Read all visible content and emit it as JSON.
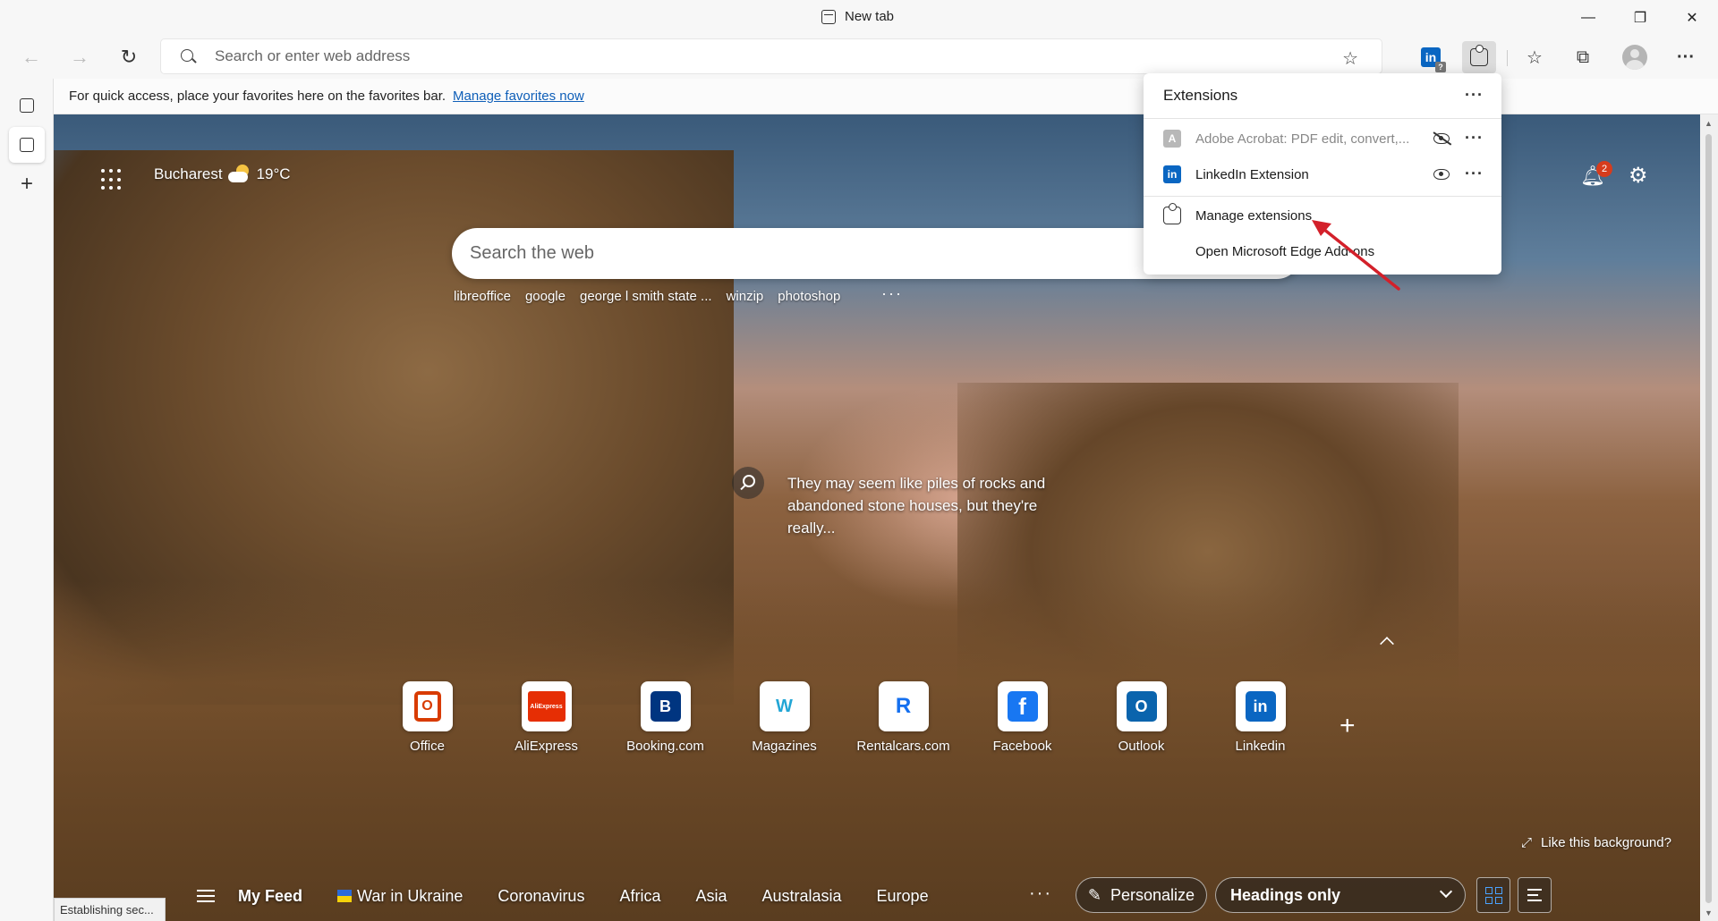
{
  "window": {
    "tab_title": "New tab",
    "minimize": "—",
    "restore": "❐",
    "close": "✕"
  },
  "toolbar": {
    "back": "←",
    "forward": "→",
    "refresh": "↻",
    "address_placeholder": "Search or enter web address",
    "favorites_star": "☆",
    "favorites": "☆",
    "collections": "⧉",
    "more": "···",
    "linkedin_badge": "in",
    "linkedin_q": "?"
  },
  "favbar": {
    "text": "For quick access, place your favorites here on the favorites bar.",
    "link": "Manage favorites now"
  },
  "sidebar": {
    "add": "+"
  },
  "ntp": {
    "city": "Bucharest",
    "temperature": "19°C",
    "notifications_count": "2",
    "search_placeholder": "Search the web",
    "suggestions": [
      "libreoffice",
      "google",
      "george l smith state ...",
      "winzip",
      "photoshop"
    ],
    "suggestions_more": "···",
    "caption": "They may seem like piles of rocks and abandoned stone houses, but they're really...",
    "like_background": "Like this background?",
    "add_link": "+"
  },
  "quicklinks": [
    {
      "label": "Office",
      "logo": "O",
      "color": "#d83b01"
    },
    {
      "label": "AliExpress",
      "logo": "AliExpress",
      "color": "#e62e04"
    },
    {
      "label": "Booking.com",
      "logo": "B",
      "color": "#003580"
    },
    {
      "label": "Magazines",
      "logo": "W",
      "color": "#23a6d5"
    },
    {
      "label": "Rentalcars.com",
      "logo": "R",
      "color": "#1570ef"
    },
    {
      "label": "Facebook",
      "logo": "f",
      "color": "#1877f2"
    },
    {
      "label": "Outlook",
      "logo": "O",
      "color": "#0a64ad"
    },
    {
      "label": "Linkedin",
      "logo": "in",
      "color": "#0a66c2"
    }
  ],
  "feed": {
    "items": [
      "My Feed",
      "War in Ukraine",
      "Coronavirus",
      "Africa",
      "Asia",
      "Australasia",
      "Europe"
    ],
    "more": "···",
    "personalize": "Personalize",
    "layout": "Headings only"
  },
  "status": "Establishing sec...",
  "extensions": {
    "title": "Extensions",
    "more": "···",
    "items": [
      {
        "name": "Adobe Acrobat: PDF edit, convert,...",
        "visible": false,
        "more": "···",
        "icon_text": "A",
        "color": "#b8b8b8"
      },
      {
        "name": "LinkedIn Extension",
        "visible": true,
        "more": "···",
        "icon_text": "in",
        "color": "#0a66c2"
      }
    ],
    "manage": "Manage extensions",
    "addons": "Open Microsoft Edge Add-ons"
  },
  "colors": {
    "accent": "#0f5fb8",
    "annotation_arrow": "#d3202a"
  }
}
